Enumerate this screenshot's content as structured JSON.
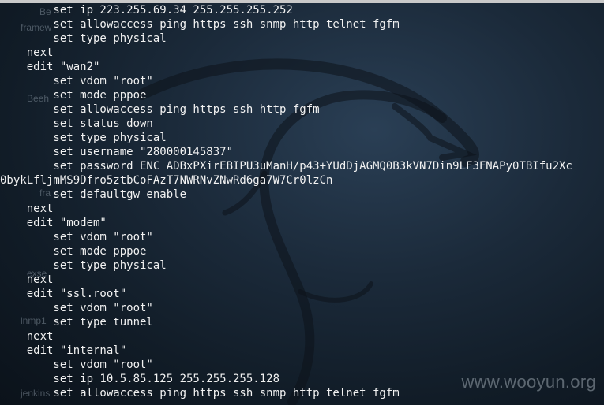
{
  "desktop_icons": [
    "Be",
    "framew",
    "Beeh",
    "fra",
    "exse",
    "lnmp1",
    "jenkins"
  ],
  "watermark": "www.wooyun.org",
  "terminal": {
    "lines": [
      "        set ip 223.255.69.34 255.255.255.252",
      "        set allowaccess ping https ssh snmp http telnet fgfm",
      "        set type physical",
      "    next",
      "    edit \"wan2\"",
      "        set vdom \"root\"",
      "        set mode pppoe",
      "        set allowaccess ping https ssh http fgfm",
      "        set status down",
      "        set type physical",
      "        set username \"280000145837\"",
      "        set password ENC ADBxPXirEBIPU3uManH/p43+YUdDjAGMQ0B3kVN7Din9LF3FNAPy0TBIfu2Xc",
      "0bykLfljmMS9Dfro5ztbCoFAzT7NWRNvZNwRd6ga7W7Cr0lzCn",
      "        set defaultgw enable",
      "    next",
      "    edit \"modem\"",
      "        set vdom \"root\"",
      "        set mode pppoe",
      "        set type physical",
      "    next",
      "    edit \"ssl.root\"",
      "        set vdom \"root\"",
      "        set type tunnel",
      "    next",
      "    edit \"internal\"",
      "        set vdom \"root\"",
      "        set ip 10.5.85.125 255.255.255.128",
      "        set allowaccess ping https ssh snmp http telnet fgfm"
    ]
  }
}
